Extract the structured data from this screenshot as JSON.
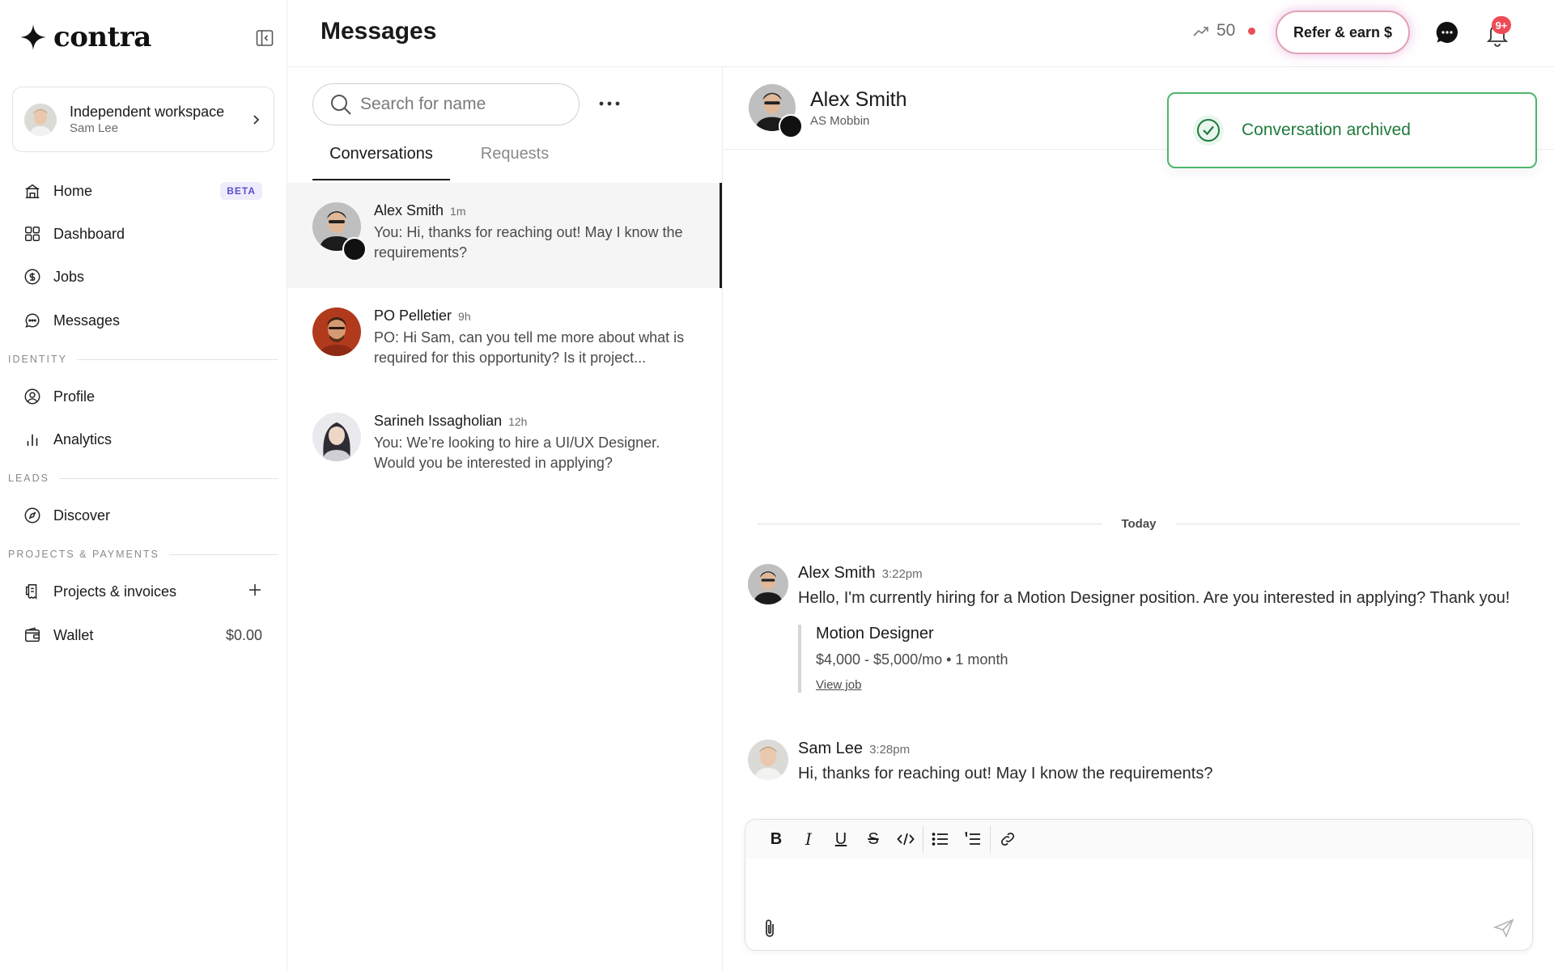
{
  "app": {
    "logo_text": "contra"
  },
  "workspace": {
    "name": "Independent workspace",
    "user": "Sam Lee"
  },
  "nav": {
    "home": {
      "label": "Home",
      "badge": "BETA"
    },
    "dashboard": {
      "label": "Dashboard"
    },
    "jobs": {
      "label": "Jobs"
    },
    "messages": {
      "label": "Messages"
    },
    "identity_label": "IDENTITY",
    "profile": {
      "label": "Profile"
    },
    "analytics": {
      "label": "Analytics"
    },
    "leads_label": "LEADS",
    "discover": {
      "label": "Discover"
    },
    "projects_label": "PROJECTS & PAYMENTS",
    "projects": {
      "label": "Projects & invoices"
    },
    "wallet": {
      "label": "Wallet",
      "balance": "$0.00"
    }
  },
  "header": {
    "title": "Messages",
    "streak": "50",
    "refer_label": "Refer & earn $",
    "notif_badge": "9+"
  },
  "list": {
    "search_placeholder": "Search for name",
    "tabs": {
      "conversations": "Conversations",
      "requests": "Requests"
    },
    "items": [
      {
        "name": "Alex Smith",
        "time": "1m",
        "preview": "You: Hi, thanks for reaching out! May I know the requirements?"
      },
      {
        "name": "PO Pelletier",
        "time": "9h",
        "preview": "PO: Hi Sam, can you tell me more about what is required for this opportunity? Is it project..."
      },
      {
        "name": "Sarineh Issagholian",
        "time": "12h",
        "preview": "You: We’re looking to hire a UI/UX Designer. Would you be interested in applying?"
      }
    ]
  },
  "chat": {
    "contact_name": "Alex Smith",
    "contact_sub": "AS Mobbin",
    "toast": "Conversation archived",
    "day_label": "Today",
    "messages": [
      {
        "name": "Alex Smith",
        "time": "3:22pm",
        "text": "Hello, I'm currently hiring for a Motion Designer position. Are you interested in applying? Thank you!",
        "job": {
          "title": "Motion Designer",
          "meta": "$4,000 - $5,000/mo • 1 month",
          "link": "View job"
        }
      },
      {
        "name": "Sam Lee",
        "time": "3:28pm",
        "text": "Hi, thanks for reaching out! May I know the requirements?"
      }
    ],
    "composer": {
      "tools": {
        "bold": "B",
        "italic": "I",
        "underline": "U",
        "strike": "S"
      }
    }
  },
  "colors": {
    "accent": "#1a1a1a",
    "success": "#4fb56b",
    "alert": "#ef4a58"
  }
}
